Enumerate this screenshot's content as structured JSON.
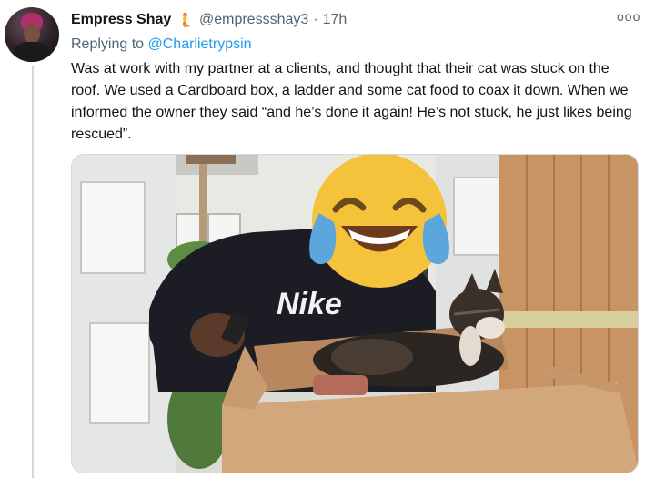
{
  "tweet": {
    "author_name": "Empress Shay",
    "badge_emoji": "🧜",
    "handle": "@empressshay3",
    "separator": "·",
    "time": "17h",
    "more_icon": "more-dots-icon",
    "more_label": "ooo",
    "reply_prefix": "Replying to",
    "reply_to": "@Charlietrypsin",
    "text": "Was at work with my partner at a clients, and thought that their cat was stuck on the roof. We used a Cardboard box, a ladder and some cat food to coax it down. When we informed the owner they said “and he’s done it again! He’s not stuck, he just likes being rescued”.",
    "image": {
      "hoodie_text": "Nike",
      "face_cover": "face-with-tears-of-joy-emoji"
    }
  },
  "colors": {
    "link": "#1d9bf0",
    "secondary_text": "#536471",
    "thread_line": "#cfd9de"
  }
}
